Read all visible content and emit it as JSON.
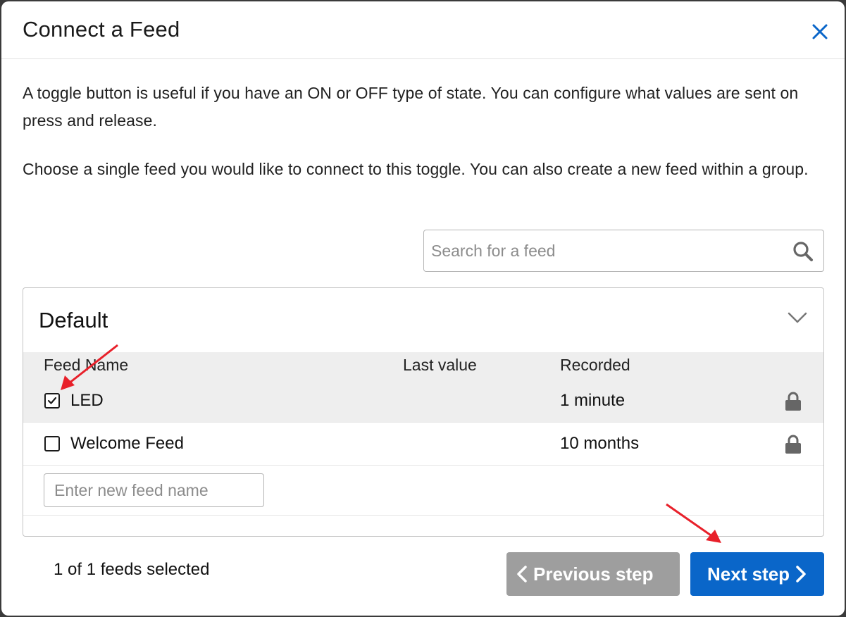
{
  "modal": {
    "title": "Connect a Feed",
    "description_1": "A toggle button is useful if you have an ON or OFF type of state. You can configure what values are sent on press and release.",
    "description_2": "Choose a single feed you would like to connect to this toggle. You can also create a new feed within a group."
  },
  "search": {
    "placeholder": "Search for a feed",
    "icon": "search-icon"
  },
  "group": {
    "name": "Default",
    "columns": {
      "feed_name": "Feed Name",
      "last_value": "Last value",
      "recorded": "Recorded"
    },
    "feeds": [
      {
        "name": "LED",
        "last_value": "",
        "recorded": "1 minute",
        "checked": true,
        "icon": "lock-icon"
      },
      {
        "name": "Welcome Feed",
        "last_value": "",
        "recorded": "10 months",
        "checked": false,
        "icon": "lock-icon"
      }
    ],
    "new_feed_placeholder": "Enter new feed name"
  },
  "footer": {
    "selected_count": "1 of 1 feeds selected",
    "prev_label": "Previous step",
    "next_label": "Next step"
  },
  "colors": {
    "primary": "#0a66c9",
    "disabled": "#9e9e9e",
    "annotation": "#e8202a"
  }
}
